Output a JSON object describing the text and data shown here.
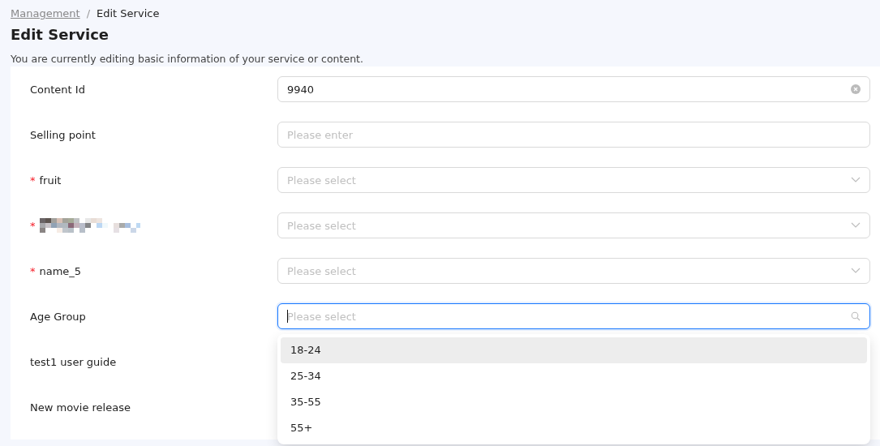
{
  "breadcrumb": {
    "parent": "Management",
    "separator": "/",
    "current": "Edit Service"
  },
  "title": "Edit Service",
  "description": "You are currently editing basic information of your service or content.",
  "form": [
    {
      "label": "Content Id",
      "kind": "input",
      "value": "9940",
      "clearable": true
    },
    {
      "label": "Selling point",
      "kind": "input",
      "placeholder": "Please enter"
    },
    {
      "label": "fruit",
      "required_mark": "*",
      "kind": "select",
      "placeholder": "Please select"
    },
    {
      "masked": true,
      "required_mark": "*",
      "kind": "select",
      "placeholder": "Please select"
    },
    {
      "label": "name_5",
      "required_mark": "*",
      "kind": "select",
      "placeholder": "Please select"
    },
    {
      "label": "Age Group",
      "kind": "search",
      "placeholder": "Please select",
      "focused": true,
      "options": [
        {
          "label": "18-24",
          "highlighted": true
        },
        {
          "label": "25-34",
          "highlighted": false
        },
        {
          "label": "35-55",
          "highlighted": false
        },
        {
          "label": "55+",
          "highlighted": false
        }
      ]
    },
    {
      "label": "test1 user guide",
      "kind": "none"
    },
    {
      "label": "New movie release",
      "kind": "none"
    }
  ]
}
